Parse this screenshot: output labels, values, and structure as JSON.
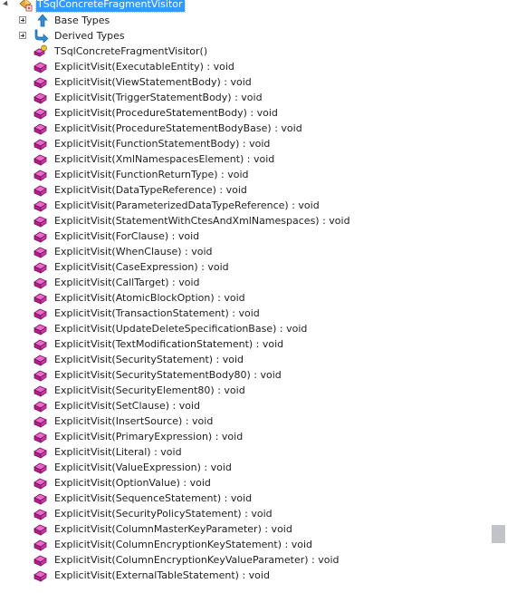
{
  "tree": {
    "root": {
      "label": "TSqlConcreteFragmentVisitor",
      "icon": "class-icon"
    },
    "groups": [
      {
        "label": "Base Types",
        "icon": "base-types-icon"
      },
      {
        "label": "Derived Types",
        "icon": "derived-types-icon"
      }
    ],
    "members": [
      {
        "label": "TSqlConcreteFragmentVisitor()",
        "icon": "constructor-icon"
      },
      {
        "label": "ExplicitVisit(ExecutableEntity) : void",
        "icon": "method-icon"
      },
      {
        "label": "ExplicitVisit(ViewStatementBody) : void",
        "icon": "method-icon"
      },
      {
        "label": "ExplicitVisit(TriggerStatementBody) : void",
        "icon": "method-icon"
      },
      {
        "label": "ExplicitVisit(ProcedureStatementBody) : void",
        "icon": "method-icon"
      },
      {
        "label": "ExplicitVisit(ProcedureStatementBodyBase) : void",
        "icon": "method-icon"
      },
      {
        "label": "ExplicitVisit(FunctionStatementBody) : void",
        "icon": "method-icon"
      },
      {
        "label": "ExplicitVisit(XmlNamespacesElement) : void",
        "icon": "method-icon"
      },
      {
        "label": "ExplicitVisit(FunctionReturnType) : void",
        "icon": "method-icon"
      },
      {
        "label": "ExplicitVisit(DataTypeReference) : void",
        "icon": "method-icon"
      },
      {
        "label": "ExplicitVisit(ParameterizedDataTypeReference) : void",
        "icon": "method-icon"
      },
      {
        "label": "ExplicitVisit(StatementWithCtesAndXmlNamespaces) : void",
        "icon": "method-icon"
      },
      {
        "label": "ExplicitVisit(ForClause) : void",
        "icon": "method-icon"
      },
      {
        "label": "ExplicitVisit(WhenClause) : void",
        "icon": "method-icon"
      },
      {
        "label": "ExplicitVisit(CaseExpression) : void",
        "icon": "method-icon"
      },
      {
        "label": "ExplicitVisit(CallTarget) : void",
        "icon": "method-icon"
      },
      {
        "label": "ExplicitVisit(AtomicBlockOption) : void",
        "icon": "method-icon"
      },
      {
        "label": "ExplicitVisit(TransactionStatement) : void",
        "icon": "method-icon"
      },
      {
        "label": "ExplicitVisit(UpdateDeleteSpecificationBase) : void",
        "icon": "method-icon"
      },
      {
        "label": "ExplicitVisit(TextModificationStatement) : void",
        "icon": "method-icon"
      },
      {
        "label": "ExplicitVisit(SecurityStatement) : void",
        "icon": "method-icon"
      },
      {
        "label": "ExplicitVisit(SecurityStatementBody80) : void",
        "icon": "method-icon"
      },
      {
        "label": "ExplicitVisit(SecurityElement80) : void",
        "icon": "method-icon"
      },
      {
        "label": "ExplicitVisit(SetClause) : void",
        "icon": "method-icon"
      },
      {
        "label": "ExplicitVisit(InsertSource) : void",
        "icon": "method-icon"
      },
      {
        "label": "ExplicitVisit(PrimaryExpression) : void",
        "icon": "method-icon"
      },
      {
        "label": "ExplicitVisit(Literal) : void",
        "icon": "method-icon"
      },
      {
        "label": "ExplicitVisit(ValueExpression) : void",
        "icon": "method-icon"
      },
      {
        "label": "ExplicitVisit(OptionValue) : void",
        "icon": "method-icon"
      },
      {
        "label": "ExplicitVisit(SequenceStatement) : void",
        "icon": "method-icon"
      },
      {
        "label": "ExplicitVisit(SecurityPolicyStatement) : void",
        "icon": "method-icon"
      },
      {
        "label": "ExplicitVisit(ColumnMasterKeyParameter) : void",
        "icon": "method-icon"
      },
      {
        "label": "ExplicitVisit(ColumnEncryptionKeyStatement) : void",
        "icon": "method-icon"
      },
      {
        "label": "ExplicitVisit(ColumnEncryptionKeyValueParameter) : void",
        "icon": "method-icon"
      },
      {
        "label": "ExplicitVisit(ExternalTableStatement) : void",
        "icon": "method-icon"
      }
    ]
  },
  "colors": {
    "selection": "#3399ff",
    "method": "#c8289b",
    "base_arrow": "#2e8fd8",
    "scroll_thumb": "#c2c3c9"
  }
}
